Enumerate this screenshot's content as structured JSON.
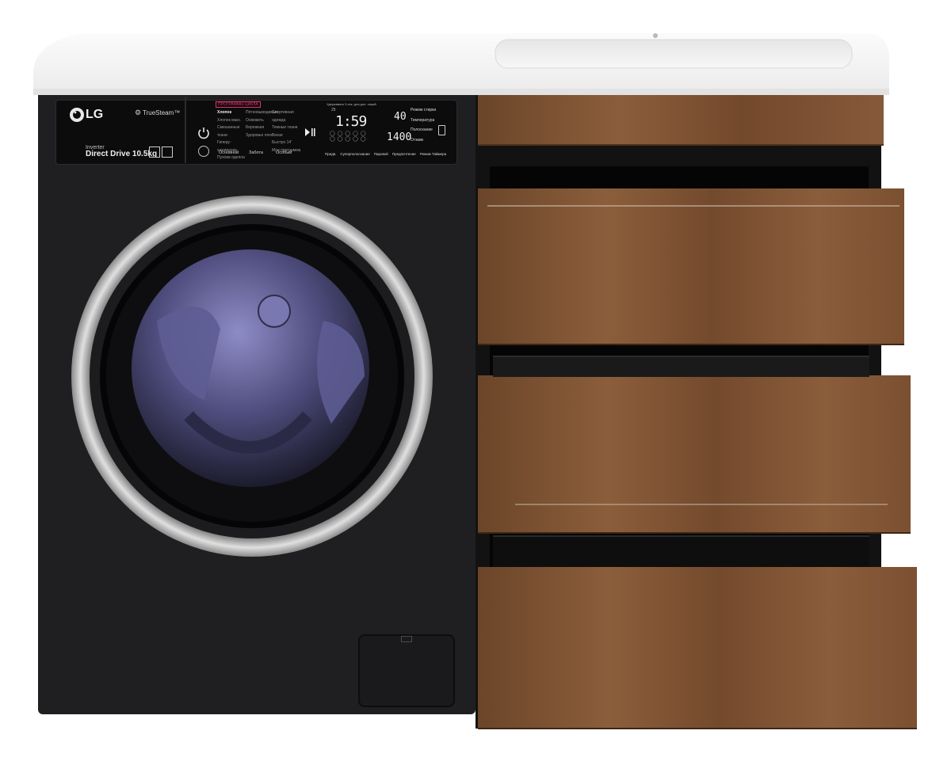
{
  "washer": {
    "brand": "LG",
    "feature": "TrueSteam™",
    "motor_line1": "Inverter",
    "motor_line2": "Direct Drive 10.5kg",
    "display": {
      "time": "1:59",
      "temperature": "40",
      "spin": "1400",
      "temp_small": "25",
      "header_note": "Удерживать 3 сек. для доп. опций"
    },
    "programs": {
      "title": "ПРОГРАММЫ ЦИКЛА",
      "col1": [
        "Хлопок",
        "Хлопок макс.",
        "Смешанные ткани",
        "Гиперу­хаживание",
        "Пухова одеяла"
      ],
      "col2": [
        "Пятновыводимые",
        "Освежить",
        "Бережная",
        "Здоровье плюс"
      ],
      "col3": [
        "Спортивная одежда",
        "Темные ткани",
        "Тихая",
        "Быстро 14'",
        "Моя программа"
      ]
    },
    "side_labels": [
      "Режим стирки",
      "Температура",
      "Полоскание",
      "Отжим"
    ],
    "bottom_labels": [
      "Основной",
      "Забота",
      "Особый"
    ],
    "right_bottom_labels": [
      "Предв.",
      "Суперполоскание",
      "Паровой",
      "Предпочтение",
      "Режим Таймера"
    ]
  },
  "colors": {
    "countertop": "#f4f4f4",
    "washer_body": "#1e1e20",
    "wood": "#7a5234",
    "wood_dark": "#5a3a24",
    "frame": "#141414",
    "drum": "#6b6a9c",
    "chrome": "#c9c9c9"
  },
  "icons": [
    "power-icon",
    "play-pause-icon",
    "lg-logo",
    "steam-icon"
  ]
}
